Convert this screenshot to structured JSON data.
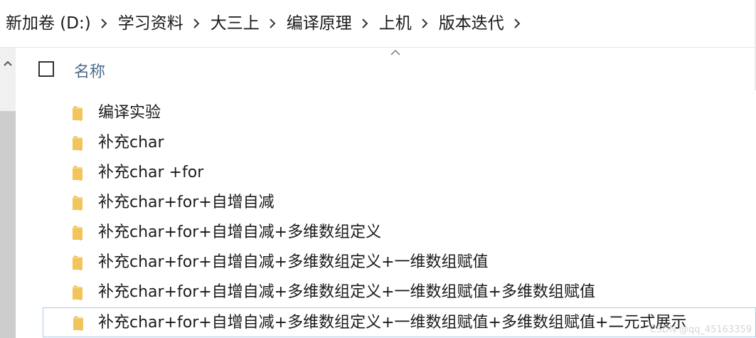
{
  "address_bar": {
    "breadcrumbs": [
      "新加卷 (D:)",
      "学习资料",
      "大三上",
      "编译原理",
      "上机",
      "版本迭代"
    ]
  },
  "header": {
    "name_column": "名称"
  },
  "files": [
    {
      "name": "编译实验"
    },
    {
      "name": "补充char"
    },
    {
      "name": "补充char +for"
    },
    {
      "name": "补充char+for+自增自减"
    },
    {
      "name": "补充char+for+自增自减+多维数组定义"
    },
    {
      "name": "补充char+for+自增自减+多维数组定义+一维数组赋值"
    },
    {
      "name": "补充char+for+自增自减+多维数组定义+一维数组赋值+多维数组赋值"
    },
    {
      "name": "补充char+for+自增自减+多维数组定义+一维数组赋值+多维数组赋值+二元式展示"
    }
  ],
  "watermark": "CSDN @qq_45163359",
  "colors": {
    "folder": "#f2c55c",
    "header_text": "#4c6a8a",
    "selection_border": "#a9cbe8",
    "scroll_thumb": "#cdcdcd"
  }
}
